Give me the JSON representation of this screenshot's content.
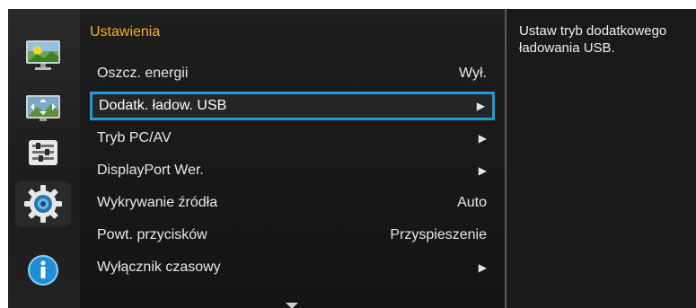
{
  "menu": {
    "title": "Ustawienia",
    "items": [
      {
        "label": "Oszcz. energii",
        "value": "Wył.",
        "arrow": false,
        "selected": false
      },
      {
        "label": "Dodatk. ładow. USB",
        "value": "▶",
        "arrow": true,
        "selected": true
      },
      {
        "label": "Tryb PC/AV",
        "value": "▶",
        "arrow": true,
        "selected": false
      },
      {
        "label": "DisplayPort Wer.",
        "value": "▶",
        "arrow": true,
        "selected": false
      },
      {
        "label": "Wykrywanie źródła",
        "value": "Auto",
        "arrow": false,
        "selected": false
      },
      {
        "label": "Powt. przycisków",
        "value": "Przyspieszenie",
        "arrow": false,
        "selected": false
      },
      {
        "label": "Wyłącznik czasowy",
        "value": "▶",
        "arrow": true,
        "selected": false
      }
    ]
  },
  "help": {
    "text": "Ustaw tryb dodatkowego ładowania USB."
  },
  "rail": {
    "icons": [
      "picture-icon",
      "screen-adjust-icon",
      "on-screen-display-icon",
      "system-settings-icon",
      "information-icon"
    ],
    "active": "system-settings-icon"
  },
  "colors": {
    "accent_title": "#f0b428",
    "selection_border": "#1e9ce0"
  }
}
